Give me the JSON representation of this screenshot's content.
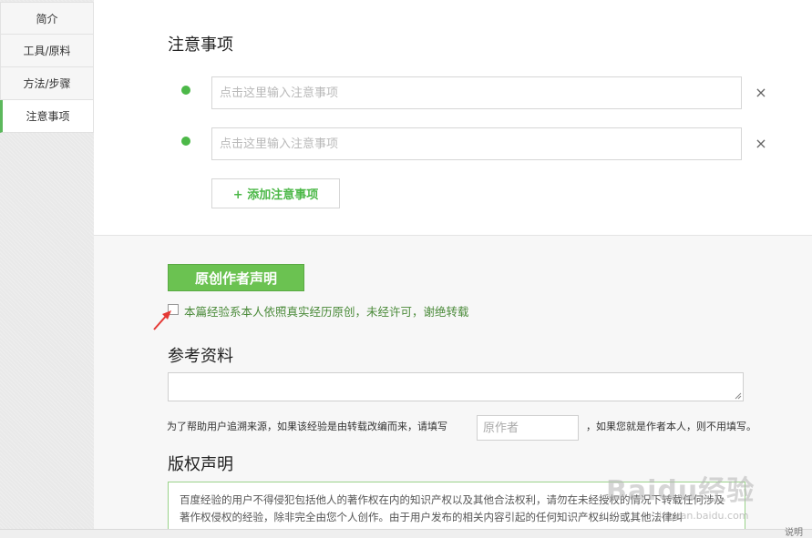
{
  "sidebar": {
    "items": [
      {
        "label": "简介"
      },
      {
        "label": "工具/原料"
      },
      {
        "label": "方法/步骤"
      },
      {
        "label": "注意事项"
      }
    ]
  },
  "notes": {
    "title": "注意事项",
    "inputs": [
      {
        "placeholder": "点击这里输入注意事项",
        "value": ""
      },
      {
        "placeholder": "点击这里输入注意事项",
        "value": ""
      }
    ],
    "remove_glyph": "×",
    "add_label": "+ 添加注意事项"
  },
  "original": {
    "button_label": "原创作者声明",
    "checkbox_label": "本篇经验系本人依照真实经历原创，未经许可，谢绝转载",
    "checked": false
  },
  "references": {
    "title": "参考资料",
    "hint_before": "为了帮助用户追溯来源，如果该经验是由转载改编而来，请填写",
    "author_placeholder": "原作者",
    "hint_after": "，如果您就是作者本人，则不用填写。"
  },
  "copyright": {
    "title": "版权声明",
    "text": "百度经验的用户不得侵犯包括他人的著作权在内的知识产权以及其他合法权利，请勿在未经授权的情况下转载任何涉及著作权侵权的经验，除非完全由您个人创作。由于用户发布的相关内容引起的任何知识产权纠纷或其他法律纠"
  },
  "watermark": {
    "brand": "Baidu经验",
    "sub": "jingyan.baidu.com"
  },
  "bottom": {
    "tail": "说明"
  },
  "colors": {
    "accent_green": "#4cb848",
    "button_green": "#6bc251",
    "arrow_red": "#e53935"
  }
}
